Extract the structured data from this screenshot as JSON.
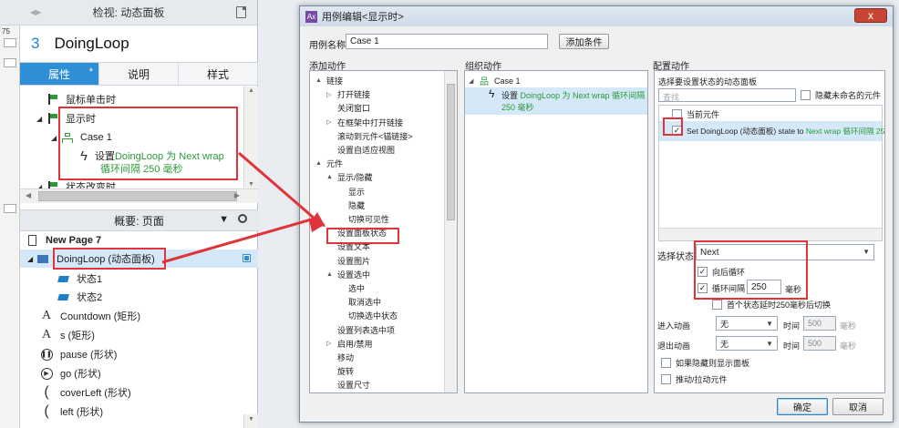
{
  "left_panel": {
    "header_title": "检视: 动态面板",
    "gutter_label": "75",
    "widget_number": "3",
    "widget_name": "DoingLoop",
    "tabs": [
      {
        "label": "属性",
        "star": "*"
      },
      {
        "label": "说明"
      },
      {
        "label": "样式"
      }
    ],
    "events": {
      "on_click": "鼠标单击时",
      "on_show": "显示时",
      "case": "Case 1",
      "action_prefix": "设置 ",
      "action_link1": "DoingLoop 为 Next wrap",
      "action_link2": "循环间隔 250 毫秒",
      "on_state_change": "状态改变时"
    },
    "outline_title": "概要: 页面",
    "outline": {
      "page": "New Page 7",
      "panel": "DoingLoop (动态面板)",
      "state1": "状态1",
      "state2": "状态2",
      "items": [
        {
          "icon": "A",
          "label": "Countdown (矩形)"
        },
        {
          "icon": "A",
          "label": "s (矩形)"
        },
        {
          "icon": "pause",
          "label": "pause (形状)"
        },
        {
          "icon": "play",
          "label": "go (形状)"
        },
        {
          "icon": "moon",
          "label": "coverLeft (形状)"
        },
        {
          "icon": "moon",
          "label": "left (形状)"
        }
      ]
    }
  },
  "dialog": {
    "title": "用例编辑<显示时>",
    "close_label": "x",
    "case_name_label": "用例名称",
    "case_name_value": "Case 1",
    "add_condition": "添加条件",
    "add_action_title": "添加动作",
    "organize_title": "组织动作",
    "configure_title": "配置动作",
    "actions_tree": [
      {
        "label": "链接",
        "level": 0,
        "tri": "▲"
      },
      {
        "label": "打开链接",
        "level": 1,
        "tri": "▷"
      },
      {
        "label": "关闭窗口",
        "level": 1,
        "tri": ""
      },
      {
        "label": "在框架中打开链接",
        "level": 1,
        "tri": "▷"
      },
      {
        "label": "滚动到元件<锚链接>",
        "level": 1,
        "tri": ""
      },
      {
        "label": "设置自适应视图",
        "level": 1,
        "tri": ""
      },
      {
        "label": "元件",
        "level": 0,
        "tri": "▲"
      },
      {
        "label": "显示/隐藏",
        "level": 1,
        "tri": "▲"
      },
      {
        "label": "显示",
        "level": 2,
        "tri": ""
      },
      {
        "label": "隐藏",
        "level": 2,
        "tri": ""
      },
      {
        "label": "切换可见性",
        "level": 2,
        "tri": ""
      },
      {
        "label": "设置面板状态",
        "level": 1,
        "tri": ""
      },
      {
        "label": "设置文本",
        "level": 1,
        "tri": ""
      },
      {
        "label": "设置图片",
        "level": 1,
        "tri": ""
      },
      {
        "label": "设置选中",
        "level": 1,
        "tri": "▲"
      },
      {
        "label": "选中",
        "level": 2,
        "tri": ""
      },
      {
        "label": "取消选中",
        "level": 2,
        "tri": ""
      },
      {
        "label": "切换选中状态",
        "level": 2,
        "tri": ""
      },
      {
        "label": "设置列表选中项",
        "level": 1,
        "tri": ""
      },
      {
        "label": "启用/禁用",
        "level": 1,
        "tri": "▷"
      },
      {
        "label": "移动",
        "level": 1,
        "tri": ""
      },
      {
        "label": "旋转",
        "level": 1,
        "tri": ""
      },
      {
        "label": "设置尺寸",
        "level": 1,
        "tri": ""
      }
    ],
    "organize": {
      "case": "Case 1",
      "action_prefix": "设置 ",
      "action_link": "DoingLoop 为 Next wrap 循环间隔",
      "action_link2": "250 毫秒"
    },
    "configure": {
      "select_panel_label": "选择要设置状态的动态面板",
      "hide_unnamed": "隐藏未命名的元件",
      "search_placeholder": "查找",
      "current_widget": "当前元件",
      "item_prefix": "Set DoingLoop (动态面板) state to ",
      "item_link": "Next wrap 循环间隔 250",
      "select_state_label": "选择状态",
      "state_value": "Next",
      "wrap_label": "向后循环",
      "loop_label": "循环间隔",
      "loop_value": "250",
      "ms": "毫秒",
      "first_delay": "首个状态延时250毫秒后切换",
      "enter_anim": "进入动画",
      "exit_anim": "退出动画",
      "anim_none": "无",
      "time_label": "时间",
      "time_value": "500",
      "show_if_hidden": "如果隐藏则显示面板",
      "push_pull": "推动/拉动元件"
    },
    "ok": "确定",
    "cancel": "取消"
  }
}
